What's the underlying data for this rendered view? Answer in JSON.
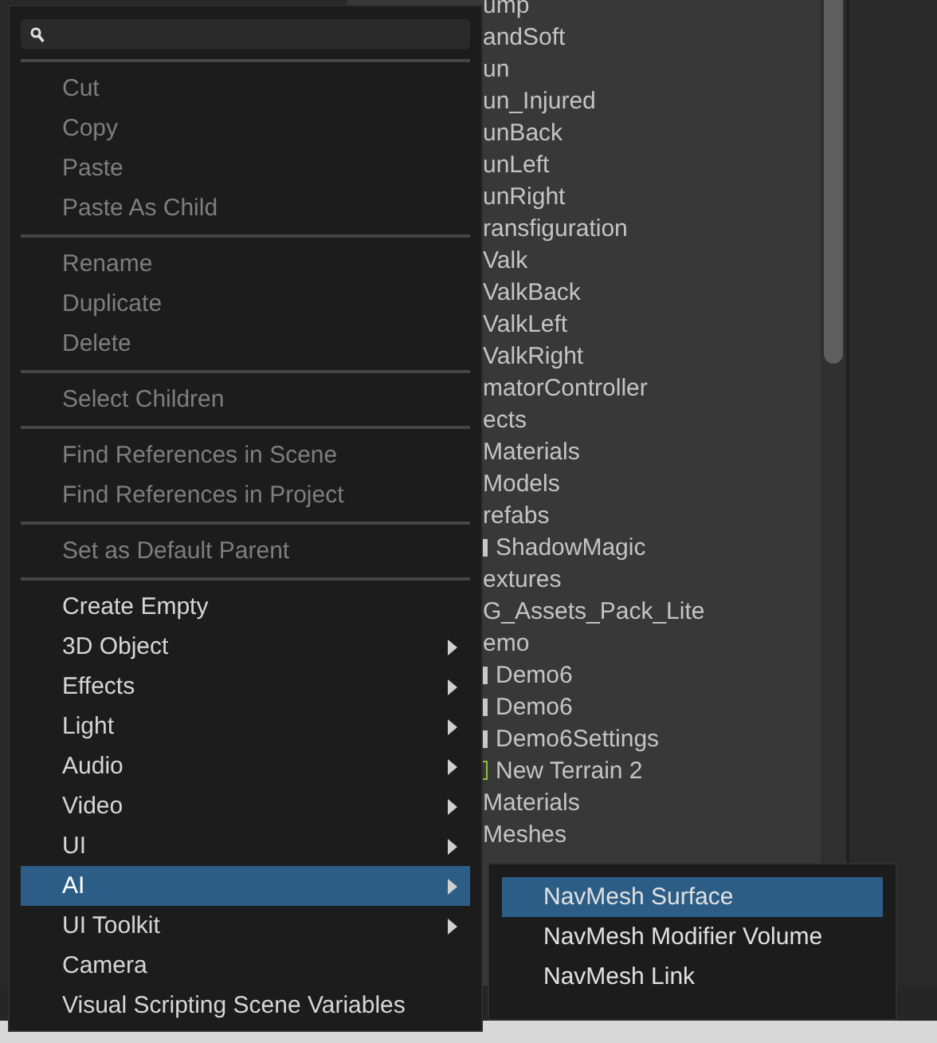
{
  "project_list": {
    "rows": [
      {
        "label": "ump",
        "kind": "plain"
      },
      {
        "label": "andSoft",
        "kind": "plain"
      },
      {
        "label": "un",
        "kind": "plain"
      },
      {
        "label": "un_Injured",
        "kind": "plain"
      },
      {
        "label": "unBack",
        "kind": "plain"
      },
      {
        "label": "unLeft",
        "kind": "plain"
      },
      {
        "label": "unRight",
        "kind": "plain"
      },
      {
        "label": "ransfiguration",
        "kind": "plain"
      },
      {
        "label": "Valk",
        "kind": "plain"
      },
      {
        "label": "ValkBack",
        "kind": "plain"
      },
      {
        "label": "ValkLeft",
        "kind": "plain"
      },
      {
        "label": "ValkRight",
        "kind": "plain"
      },
      {
        "label": "matorController",
        "kind": "plain"
      },
      {
        "label": "ects",
        "kind": "plain"
      },
      {
        "label": "Materials",
        "kind": "plain"
      },
      {
        "label": "Models",
        "kind": "plain"
      },
      {
        "label": "refabs",
        "kind": "plain"
      },
      {
        "label": "ShadowMagic",
        "kind": "asset"
      },
      {
        "label": "extures",
        "kind": "plain"
      },
      {
        "label": "G_Assets_Pack_Lite",
        "kind": "plain"
      },
      {
        "label": "emo",
        "kind": "plain"
      },
      {
        "label": "Demo6",
        "kind": "asset"
      },
      {
        "label": "Demo6",
        "kind": "asset"
      },
      {
        "label": "Demo6Settings",
        "kind": "asset"
      },
      {
        "label": "New Terrain 2",
        "kind": "terrain"
      },
      {
        "label": "Materials",
        "kind": "plain"
      },
      {
        "label": "Meshes",
        "kind": "plain"
      }
    ]
  },
  "context_menu": {
    "sections": [
      [
        {
          "label": "Cut",
          "disabled": true,
          "submenu": false,
          "selected": false
        },
        {
          "label": "Copy",
          "disabled": true,
          "submenu": false,
          "selected": false
        },
        {
          "label": "Paste",
          "disabled": true,
          "submenu": false,
          "selected": false
        },
        {
          "label": "Paste As Child",
          "disabled": true,
          "submenu": false,
          "selected": false
        }
      ],
      [
        {
          "label": "Rename",
          "disabled": true,
          "submenu": false,
          "selected": false
        },
        {
          "label": "Duplicate",
          "disabled": true,
          "submenu": false,
          "selected": false
        },
        {
          "label": "Delete",
          "disabled": true,
          "submenu": false,
          "selected": false
        }
      ],
      [
        {
          "label": "Select Children",
          "disabled": true,
          "submenu": false,
          "selected": false
        }
      ],
      [
        {
          "label": "Find References in Scene",
          "disabled": true,
          "submenu": false,
          "selected": false
        },
        {
          "label": "Find References in Project",
          "disabled": true,
          "submenu": false,
          "selected": false
        }
      ],
      [
        {
          "label": "Set as Default Parent",
          "disabled": true,
          "submenu": false,
          "selected": false
        }
      ],
      [
        {
          "label": "Create Empty",
          "disabled": false,
          "submenu": false,
          "selected": false
        },
        {
          "label": "3D Object",
          "disabled": false,
          "submenu": true,
          "selected": false
        },
        {
          "label": "Effects",
          "disabled": false,
          "submenu": true,
          "selected": false
        },
        {
          "label": "Light",
          "disabled": false,
          "submenu": true,
          "selected": false
        },
        {
          "label": "Audio",
          "disabled": false,
          "submenu": true,
          "selected": false
        },
        {
          "label": "Video",
          "disabled": false,
          "submenu": true,
          "selected": false
        },
        {
          "label": "UI",
          "disabled": false,
          "submenu": true,
          "selected": false
        },
        {
          "label": "AI",
          "disabled": false,
          "submenu": true,
          "selected": true
        },
        {
          "label": "UI Toolkit",
          "disabled": false,
          "submenu": true,
          "selected": false
        },
        {
          "label": "Camera",
          "disabled": false,
          "submenu": false,
          "selected": false
        },
        {
          "label": "Visual Scripting Scene Variables",
          "disabled": false,
          "submenu": false,
          "selected": false
        }
      ]
    ]
  },
  "submenu": {
    "items": [
      {
        "label": "NavMesh Surface",
        "selected": true
      },
      {
        "label": "NavMesh Modifier Volume",
        "selected": false
      },
      {
        "label": "NavMesh Link",
        "selected": false
      }
    ]
  }
}
